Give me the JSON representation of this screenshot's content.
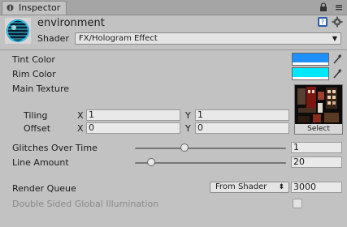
{
  "tab": {
    "label": "Inspector"
  },
  "header": {
    "title": "environment",
    "shader_label": "Shader",
    "shader_value": "FX/Hologram Effect"
  },
  "properties": {
    "tint_color": {
      "label": "Tint Color",
      "color": "#1e90ff"
    },
    "rim_color": {
      "label": "Rim Color",
      "color": "#00e8ff"
    },
    "main_texture": {
      "label": "Main Texture",
      "tiling_label": "Tiling",
      "offset_label": "Offset",
      "x_label": "X",
      "y_label": "Y",
      "tiling_x": "1",
      "tiling_y": "1",
      "offset_x": "0",
      "offset_y": "0",
      "select_label": "Select"
    },
    "glitches": {
      "label": "Glitches Over Time",
      "value": "1",
      "slider_fraction": 0.33
    },
    "line_amount": {
      "label": "Line Amount",
      "value": "20",
      "slider_fraction": 0.11
    }
  },
  "render_queue": {
    "label": "Render Queue",
    "mode": "From Shader",
    "value": "3000"
  },
  "double_sided": {
    "label": "Double Sided Global Illumination",
    "checked": false
  },
  "colors": {
    "background": "#c2c2c2",
    "accent": "#1e90ff"
  }
}
